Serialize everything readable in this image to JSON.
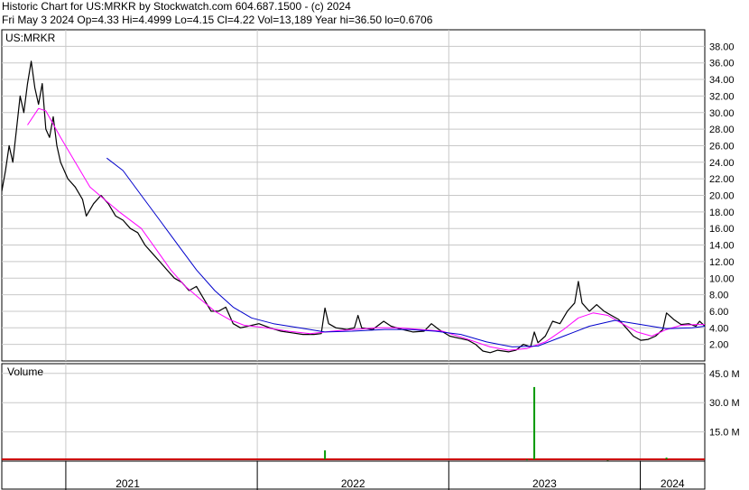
{
  "header": {
    "line1": "Historic Chart for US:MRKR by Stockwatch.com 604.687.1500 - (c) 2024",
    "line2": "Fri May  3 2024   Op=4.33   Hi=4.4999   Lo=4.15   Cl=4.22   Vol=13,189   Year hi=36.50   lo=0.6706"
  },
  "chart_data": [
    {
      "type": "line",
      "label": "US:MRKR",
      "ylim": [
        0,
        40
      ],
      "yticks": [
        2,
        4,
        6,
        8,
        10,
        12,
        14,
        16,
        18,
        20,
        22,
        24,
        26,
        28,
        30,
        32,
        34,
        36,
        38
      ],
      "ytick_labels": [
        "2.00",
        "4.00",
        "6.00",
        "8.00",
        "10.00",
        "12.00",
        "14.00",
        "16.00",
        "18.00",
        "20.00",
        "22.00",
        "24.00",
        "26.00",
        "28.00",
        "30.00",
        "32.00",
        "34.00",
        "36.00",
        "38.00"
      ],
      "x_axis": {
        "start": "2020-09-01",
        "end": "2024-05-03",
        "years": [
          "2021",
          "2022",
          "2023",
          "2024"
        ],
        "year_boundaries": [
          "2021-01-01",
          "2022-01-01",
          "2023-01-01",
          "2024-01-01"
        ]
      },
      "grid": true,
      "series": [
        {
          "role": "price",
          "color": "#000000",
          "points": [
            [
              "2020-09-01",
              20.5
            ],
            [
              "2020-09-08",
              23
            ],
            [
              "2020-09-15",
              26
            ],
            [
              "2020-09-22",
              24
            ],
            [
              "2020-09-29",
              28
            ],
            [
              "2020-10-06",
              32
            ],
            [
              "2020-10-13",
              30
            ],
            [
              "2020-10-20",
              33.5
            ],
            [
              "2020-10-27",
              36.2
            ],
            [
              "2020-11-03",
              33
            ],
            [
              "2020-11-10",
              31
            ],
            [
              "2020-11-17",
              33.5
            ],
            [
              "2020-11-24",
              28
            ],
            [
              "2020-12-01",
              27
            ],
            [
              "2020-12-08",
              29.5
            ],
            [
              "2020-12-15",
              26
            ],
            [
              "2020-12-22",
              24
            ],
            [
              "2021-01-05",
              22
            ],
            [
              "2021-01-19",
              21
            ],
            [
              "2021-02-02",
              19.5
            ],
            [
              "2021-02-09",
              17.5
            ],
            [
              "2021-02-23",
              19
            ],
            [
              "2021-03-09",
              20
            ],
            [
              "2021-03-23",
              19
            ],
            [
              "2021-04-06",
              17.5
            ],
            [
              "2021-04-20",
              17
            ],
            [
              "2021-05-04",
              16
            ],
            [
              "2021-05-18",
              15.5
            ],
            [
              "2021-06-01",
              14
            ],
            [
              "2021-06-15",
              13
            ],
            [
              "2021-06-29",
              12
            ],
            [
              "2021-07-13",
              11
            ],
            [
              "2021-07-27",
              10
            ],
            [
              "2021-08-10",
              9.5
            ],
            [
              "2021-08-24",
              8.5
            ],
            [
              "2021-09-07",
              9
            ],
            [
              "2021-09-21",
              7.5
            ],
            [
              "2021-10-05",
              6
            ],
            [
              "2021-10-19",
              6
            ],
            [
              "2021-11-02",
              6.5
            ],
            [
              "2021-11-16",
              4.5
            ],
            [
              "2021-11-30",
              4
            ],
            [
              "2021-12-14",
              4.2
            ],
            [
              "2022-01-04",
              4.5
            ],
            [
              "2022-01-25",
              4
            ],
            [
              "2022-02-15",
              3.6
            ],
            [
              "2022-03-08",
              3.4
            ],
            [
              "2022-03-29",
              3.2
            ],
            [
              "2022-04-19",
              3.2
            ],
            [
              "2022-05-03",
              3.3
            ],
            [
              "2022-05-10",
              6.4
            ],
            [
              "2022-05-17",
              4.5
            ],
            [
              "2022-05-31",
              4
            ],
            [
              "2022-06-21",
              3.8
            ],
            [
              "2022-07-05",
              4
            ],
            [
              "2022-07-12",
              5.5
            ],
            [
              "2022-07-19",
              4
            ],
            [
              "2022-08-09",
              3.8
            ],
            [
              "2022-08-30",
              4.8
            ],
            [
              "2022-09-13",
              4.2
            ],
            [
              "2022-10-04",
              3.8
            ],
            [
              "2022-10-25",
              3.5
            ],
            [
              "2022-11-15",
              3.6
            ],
            [
              "2022-11-29",
              4.5
            ],
            [
              "2022-12-13",
              3.8
            ],
            [
              "2023-01-03",
              3
            ],
            [
              "2023-01-24",
              2.7
            ],
            [
              "2023-02-07",
              2.5
            ],
            [
              "2023-02-21",
              2
            ],
            [
              "2023-03-07",
              1.2
            ],
            [
              "2023-03-21",
              1
            ],
            [
              "2023-04-04",
              1.3
            ],
            [
              "2023-04-25",
              1.1
            ],
            [
              "2023-05-09",
              1.3
            ],
            [
              "2023-05-23",
              2
            ],
            [
              "2023-06-06",
              1.7
            ],
            [
              "2023-06-13",
              3.5
            ],
            [
              "2023-06-20",
              2.2
            ],
            [
              "2023-07-04",
              3
            ],
            [
              "2023-07-18",
              4.8
            ],
            [
              "2023-08-01",
              4.5
            ],
            [
              "2023-08-15",
              6
            ],
            [
              "2023-08-29",
              7
            ],
            [
              "2023-09-05",
              9.6
            ],
            [
              "2023-09-12",
              7
            ],
            [
              "2023-09-26",
              6
            ],
            [
              "2023-10-10",
              6.8
            ],
            [
              "2023-10-24",
              6
            ],
            [
              "2023-11-07",
              5.5
            ],
            [
              "2023-11-21",
              5
            ],
            [
              "2023-12-05",
              4
            ],
            [
              "2023-12-19",
              3
            ],
            [
              "2024-01-02",
              2.5
            ],
            [
              "2024-01-16",
              2.6
            ],
            [
              "2024-01-30",
              3
            ],
            [
              "2024-02-13",
              3.8
            ],
            [
              "2024-02-20",
              5.8
            ],
            [
              "2024-03-05",
              5
            ],
            [
              "2024-03-19",
              4.4
            ],
            [
              "2024-04-02",
              4.5
            ],
            [
              "2024-04-16",
              4.2
            ],
            [
              "2024-04-23",
              4.8
            ],
            [
              "2024-05-03",
              4.22
            ]
          ]
        },
        {
          "role": "moving-average-short",
          "color": "#ff00ff",
          "points": [
            [
              "2020-10-20",
              28.5
            ],
            [
              "2020-11-10",
              30.5
            ],
            [
              "2020-11-24",
              30.2
            ],
            [
              "2020-12-22",
              27
            ],
            [
              "2021-01-19",
              24
            ],
            [
              "2021-02-16",
              21
            ],
            [
              "2021-03-16",
              19.5
            ],
            [
              "2021-04-13",
              18
            ],
            [
              "2021-05-25",
              16
            ],
            [
              "2021-06-22",
              13.5
            ],
            [
              "2021-07-20",
              11
            ],
            [
              "2021-08-17",
              9
            ],
            [
              "2021-09-14",
              7.5
            ],
            [
              "2021-10-12",
              6
            ],
            [
              "2021-11-09",
              5
            ],
            [
              "2021-12-07",
              4.3
            ],
            [
              "2022-01-18",
              4
            ],
            [
              "2022-03-01",
              3.6
            ],
            [
              "2022-04-12",
              3.3
            ],
            [
              "2022-05-24",
              3.6
            ],
            [
              "2022-07-05",
              3.8
            ],
            [
              "2022-08-16",
              4
            ],
            [
              "2022-09-27",
              4
            ],
            [
              "2022-11-08",
              3.8
            ],
            [
              "2022-12-20",
              3.6
            ],
            [
              "2023-02-07",
              2.6
            ],
            [
              "2023-03-21",
              1.7
            ],
            [
              "2023-04-25",
              1.3
            ],
            [
              "2023-05-30",
              1.5
            ],
            [
              "2023-07-04",
              2.3
            ],
            [
              "2023-08-08",
              3.8
            ],
            [
              "2023-09-05",
              5.2
            ],
            [
              "2023-10-03",
              5.8
            ],
            [
              "2023-10-31",
              5.5
            ],
            [
              "2023-11-28",
              4.5
            ],
            [
              "2023-12-26",
              3.5
            ],
            [
              "2024-01-23",
              3
            ],
            [
              "2024-02-20",
              3.8
            ],
            [
              "2024-03-19",
              4.3
            ],
            [
              "2024-04-16",
              4.4
            ],
            [
              "2024-05-03",
              4.4
            ]
          ]
        },
        {
          "role": "moving-average-long",
          "color": "#0000cc",
          "points": [
            [
              "2021-03-20",
              24.5
            ],
            [
              "2021-04-20",
              23
            ],
            [
              "2021-05-25",
              20
            ],
            [
              "2021-06-29",
              17
            ],
            [
              "2021-08-03",
              14
            ],
            [
              "2021-09-07",
              11
            ],
            [
              "2021-10-12",
              8.5
            ],
            [
              "2021-11-16",
              6.5
            ],
            [
              "2021-12-21",
              5.2
            ],
            [
              "2022-02-01",
              4.5
            ],
            [
              "2022-03-22",
              4
            ],
            [
              "2022-05-10",
              3.5
            ],
            [
              "2022-07-01",
              3.6
            ],
            [
              "2022-09-01",
              3.8
            ],
            [
              "2022-10-18",
              3.8
            ],
            [
              "2022-12-06",
              3.6
            ],
            [
              "2023-01-24",
              3.2
            ],
            [
              "2023-03-14",
              2.3
            ],
            [
              "2023-05-02",
              1.7
            ],
            [
              "2023-06-20",
              1.8
            ],
            [
              "2023-08-08",
              3
            ],
            [
              "2023-09-26",
              4.2
            ],
            [
              "2023-11-14",
              4.9
            ],
            [
              "2024-01-02",
              4.4
            ],
            [
              "2024-02-20",
              3.9
            ],
            [
              "2024-04-09",
              4
            ],
            [
              "2024-05-03",
              4.2
            ]
          ]
        }
      ]
    },
    {
      "type": "bar",
      "label": "Volume",
      "ylim": [
        0,
        50
      ],
      "yticks": [
        15,
        30,
        45
      ],
      "ytick_labels": [
        "15.0 M",
        "30.0 M",
        "45.0 M"
      ],
      "color": "#009900",
      "baseline_color": "#cc0000",
      "points": [
        [
          "2022-05-10",
          5.5
        ],
        [
          "2023-05-30",
          0.9
        ],
        [
          "2023-06-13",
          38
        ],
        [
          "2023-10-31",
          0.4
        ],
        [
          "2024-02-20",
          1.8
        ]
      ]
    }
  ]
}
